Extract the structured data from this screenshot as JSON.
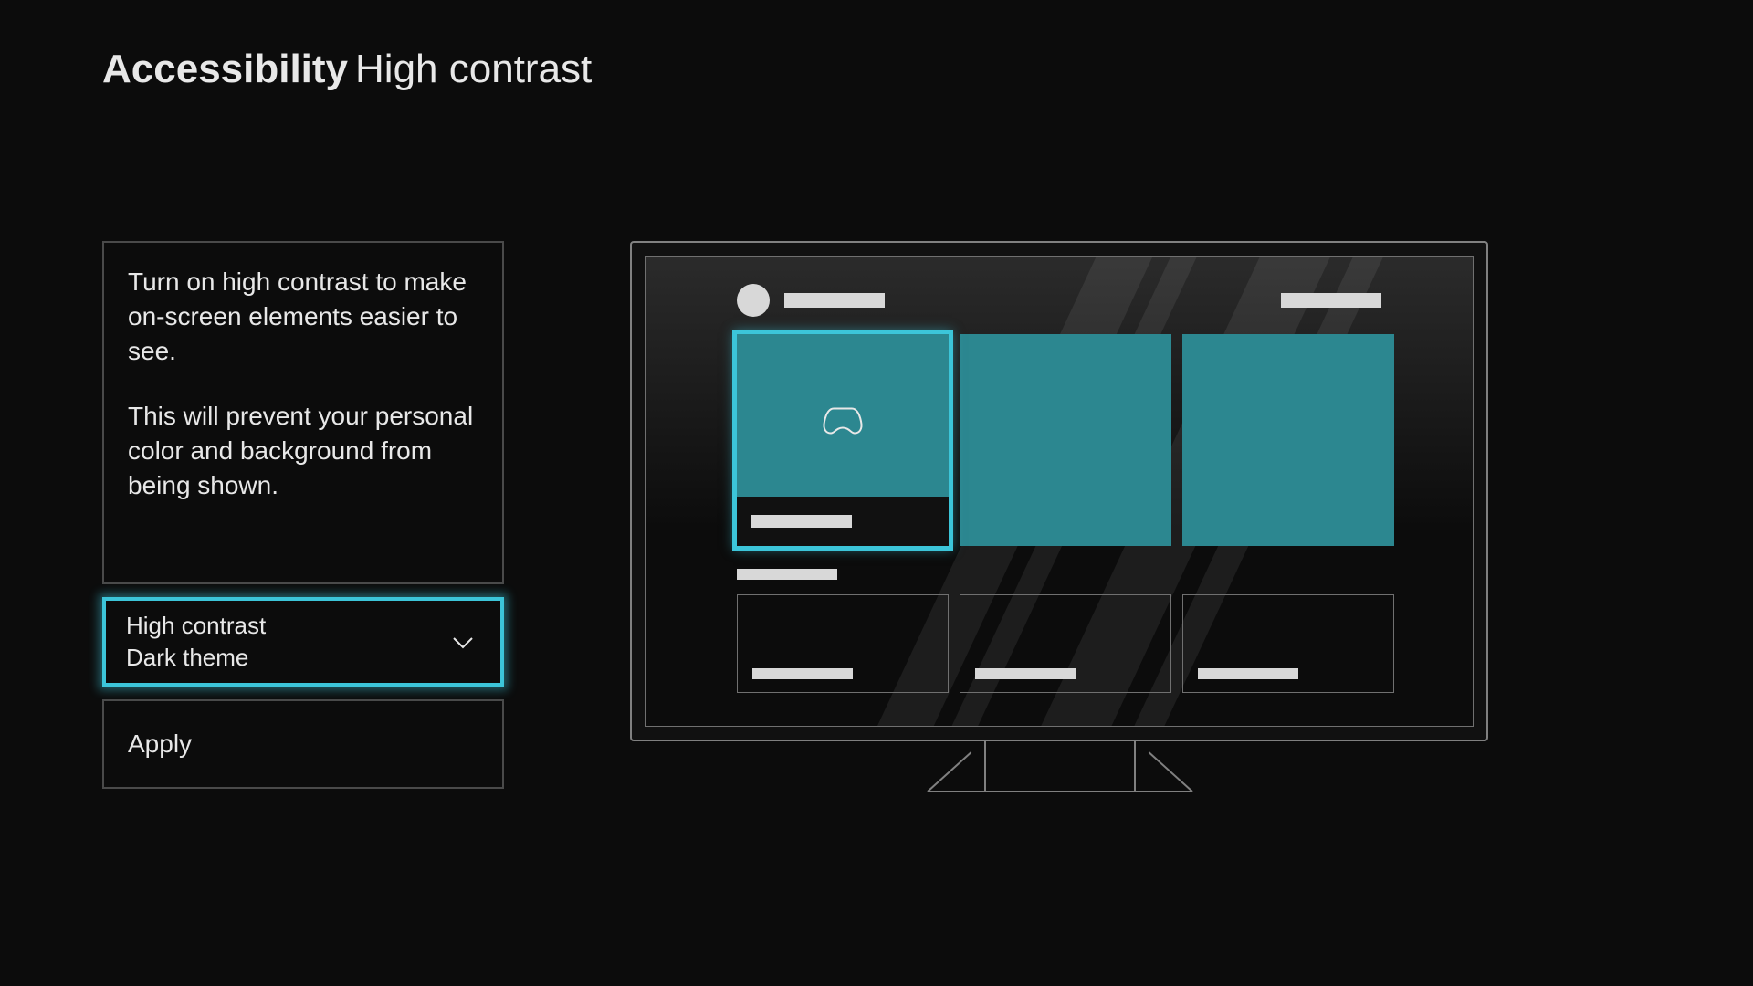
{
  "header": {
    "title_bold": "Accessibility",
    "title_light": "High contrast"
  },
  "description": {
    "p1": "Turn on high contrast to make on-screen elements easier to see.",
    "p2": "This will prevent your personal color and background from being shown."
  },
  "theme_select": {
    "label": "High contrast",
    "value": "Dark theme"
  },
  "apply": {
    "label": "Apply"
  },
  "colors": {
    "focus": "#3cc5d9",
    "tile": "#2c8790",
    "placeholder": "#d8d8d8"
  }
}
